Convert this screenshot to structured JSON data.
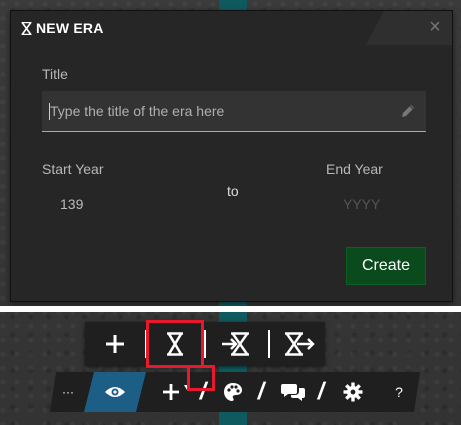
{
  "modal": {
    "title": "NEW ERA",
    "icon": "hourglass-icon",
    "close_label": "×",
    "title_label": "Title",
    "title_placeholder": "Type the title of the era here",
    "start_label": "Start Year",
    "start_value": "139",
    "to_text": "to",
    "end_label": "End Year",
    "end_placeholder": "YYYY",
    "create_label": "Create"
  },
  "toolbar_top": {
    "buttons": [
      {
        "name": "add",
        "icon": "plus-icon"
      },
      {
        "name": "era",
        "icon": "hourglass-icon",
        "highlighted": true
      },
      {
        "name": "range-in",
        "icon": "hourglass-arrow-in-icon"
      },
      {
        "name": "range-out",
        "icon": "hourglass-arrow-out-icon"
      }
    ]
  },
  "toolbar_bottom": {
    "more_label": "···",
    "help_label": "?",
    "buttons": [
      {
        "name": "view",
        "icon": "eye-icon",
        "active": true
      },
      {
        "name": "add-menu",
        "icon": "plus-caret-icon",
        "highlighted": true
      },
      {
        "name": "palette",
        "icon": "palette-icon"
      },
      {
        "name": "comments",
        "icon": "chat-bubbles-icon"
      },
      {
        "name": "settings",
        "icon": "gear-icon"
      }
    ]
  },
  "colors": {
    "create_button": "#0b4a1c",
    "accent_blue": "#1c5e86",
    "highlight_red": "#e8192c",
    "teal_strip": "#0f5a5f"
  }
}
